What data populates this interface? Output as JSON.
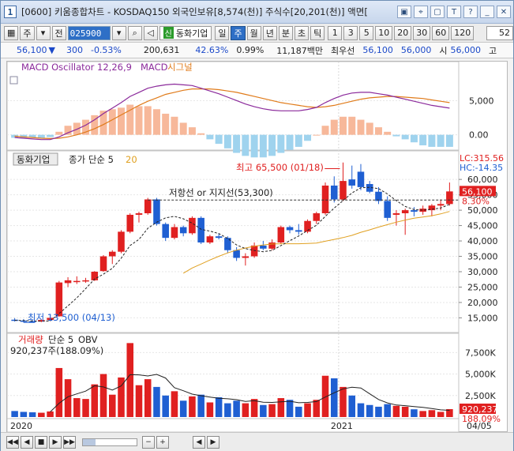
{
  "window": {
    "screen_no": "1",
    "title": "[0600] 키움종합차트 - KOSDAQ150 외국인보유[8,574(천)] 주식수[20,201(천)] 액면[",
    "icons": [
      "window-icon",
      "pin-icon",
      "restore-icon",
      "format-icon",
      "help-icon",
      "minimize-icon",
      "close-icon"
    ],
    "icon_glyphs": [
      "▣",
      "⌖",
      "▢",
      "T",
      "?",
      "_",
      "✕"
    ]
  },
  "toolbar": {
    "period_unit": "주",
    "all_label": "전",
    "stock_code": "025900",
    "stock_name": "동화기업",
    "sin_tag": "신",
    "period_buttons": [
      "일",
      "주",
      "월",
      "년",
      "분",
      "초",
      "틱"
    ],
    "active_period": "주",
    "minute_buttons": [
      "1",
      "3",
      "5",
      "10",
      "20",
      "30",
      "60",
      "120"
    ],
    "display_count": "52"
  },
  "price_bar": {
    "price": "56,100",
    "change_arrow": "▼",
    "change": "300",
    "change_rate": "-0.53%",
    "volume": "200,631",
    "volume_rate": "42.63%",
    "turnover": "0.99%",
    "amount": "11,187백만",
    "best_ask_label": "최우선",
    "best_ask": "56,100",
    "best_bid": "56,000",
    "open_label": "시",
    "open": "56,000",
    "extra": "고"
  },
  "macd_panel": {
    "legend_name": "MACD Oscillator 12,26,9",
    "legend_macd": "MACD",
    "legend_signal": "시그널",
    "ticks": [
      "5,000",
      "0.00"
    ],
    "colors": {
      "macd": "#8b2a9b",
      "signal": "#e07b1a",
      "pos": "#f7b89a",
      "neg": "#9fd3ee"
    }
  },
  "price_panel": {
    "legend_name": "동화기업",
    "legend_ma": "종가 단순 5",
    "legend_ma2": "20",
    "high_label": "최고 65,500 (01/18)",
    "low_label": "최저 13,500 (04/13)",
    "resistance_label": "저항선 or 지지선(53,300)",
    "lc_label": "LC:315.56",
    "hc_label": "HC:-14.35",
    "current_price_tag": "56,100",
    "current_rate_tag": "8.30%",
    "ticks": [
      "60,000",
      "55,000",
      "50,000",
      "45,000",
      "40,000",
      "35,000",
      "30,000",
      "25,000",
      "20,000",
      "15,000"
    ],
    "colors": {
      "up": "#e02020",
      "down": "#1f5fd2",
      "ma5": "#222222",
      "ma20": "#e0a020"
    }
  },
  "volume_panel": {
    "legend_name": "거래량",
    "legend_ma": "단순 5",
    "legend_obv": "OBV",
    "volume_info": "920,237주(188.09%)",
    "current_volume_tag": "920,237",
    "current_rate_tag": "188.09%",
    "ticks": [
      "7,500K",
      "5,000K",
      "2,500K"
    ]
  },
  "x_axis": {
    "labels": [
      "2020",
      "2021",
      "04/05"
    ]
  },
  "chart_data": {
    "type": "candlestick",
    "interval": "weekly",
    "ylim_price": [
      11000,
      68000
    ],
    "ylim_volume": [
      0,
      9000000
    ],
    "ylim_macd": [
      -2000,
      10000
    ],
    "candles": [
      {
        "o": 14400,
        "h": 14900,
        "l": 13800,
        "c": 14100
      },
      {
        "o": 14100,
        "h": 14600,
        "l": 13500,
        "c": 13900
      },
      {
        "o": 13900,
        "h": 14300,
        "l": 13500,
        "c": 13800
      },
      {
        "o": 13800,
        "h": 14500,
        "l": 13600,
        "c": 14300
      },
      {
        "o": 14300,
        "h": 15200,
        "l": 14000,
        "c": 15000
      },
      {
        "o": 15500,
        "h": 27000,
        "l": 15400,
        "c": 26500
      },
      {
        "o": 26300,
        "h": 28200,
        "l": 25000,
        "c": 27200
      },
      {
        "o": 26800,
        "h": 28500,
        "l": 26000,
        "c": 27000
      },
      {
        "o": 27000,
        "h": 28000,
        "l": 26400,
        "c": 27200
      },
      {
        "o": 27200,
        "h": 30200,
        "l": 27000,
        "c": 30000
      },
      {
        "o": 30200,
        "h": 35400,
        "l": 30000,
        "c": 35000
      },
      {
        "o": 35000,
        "h": 37000,
        "l": 32500,
        "c": 36500
      },
      {
        "o": 36500,
        "h": 43500,
        "l": 36000,
        "c": 43000
      },
      {
        "o": 43000,
        "h": 49000,
        "l": 42500,
        "c": 48500
      },
      {
        "o": 48500,
        "h": 49500,
        "l": 46000,
        "c": 49000
      },
      {
        "o": 49000,
        "h": 54000,
        "l": 48500,
        "c": 53500
      },
      {
        "o": 53500,
        "h": 54000,
        "l": 45000,
        "c": 45500
      },
      {
        "o": 45500,
        "h": 46000,
        "l": 40000,
        "c": 41000
      },
      {
        "o": 41000,
        "h": 45500,
        "l": 40500,
        "c": 44500
      },
      {
        "o": 44500,
        "h": 45000,
        "l": 41500,
        "c": 42500
      },
      {
        "o": 42500,
        "h": 48000,
        "l": 42000,
        "c": 47500
      },
      {
        "o": 47500,
        "h": 48000,
        "l": 39000,
        "c": 39500
      },
      {
        "o": 39500,
        "h": 42000,
        "l": 39000,
        "c": 41500
      },
      {
        "o": 41500,
        "h": 42500,
        "l": 40500,
        "c": 41000
      },
      {
        "o": 41000,
        "h": 41500,
        "l": 36000,
        "c": 37000
      },
      {
        "o": 37000,
        "h": 38000,
        "l": 33500,
        "c": 34500
      },
      {
        "o": 34500,
        "h": 36000,
        "l": 32000,
        "c": 35000
      },
      {
        "o": 35000,
        "h": 39500,
        "l": 34500,
        "c": 38500
      },
      {
        "o": 38500,
        "h": 40000,
        "l": 37000,
        "c": 37500
      },
      {
        "o": 37500,
        "h": 40500,
        "l": 37000,
        "c": 39500
      },
      {
        "o": 39500,
        "h": 45000,
        "l": 39000,
        "c": 44500
      },
      {
        "o": 44500,
        "h": 45000,
        "l": 42500,
        "c": 43500
      },
      {
        "o": 43500,
        "h": 45500,
        "l": 42000,
        "c": 43000
      },
      {
        "o": 43000,
        "h": 47000,
        "l": 42500,
        "c": 46500
      },
      {
        "o": 46500,
        "h": 49500,
        "l": 45500,
        "c": 49000
      },
      {
        "o": 49000,
        "h": 59000,
        "l": 48500,
        "c": 58000
      },
      {
        "o": 58000,
        "h": 61000,
        "l": 52500,
        "c": 53500
      },
      {
        "o": 53500,
        "h": 65500,
        "l": 53000,
        "c": 59500
      },
      {
        "o": 60000,
        "h": 64500,
        "l": 57000,
        "c": 58000
      },
      {
        "o": 62500,
        "h": 65000,
        "l": 56500,
        "c": 57500
      },
      {
        "o": 58500,
        "h": 59500,
        "l": 55500,
        "c": 56000
      },
      {
        "o": 56000,
        "h": 57500,
        "l": 52000,
        "c": 53000
      },
      {
        "o": 53000,
        "h": 54500,
        "l": 46500,
        "c": 47500
      },
      {
        "o": 48500,
        "h": 50000,
        "l": 45000,
        "c": 49000
      },
      {
        "o": 49000,
        "h": 50500,
        "l": 42000,
        "c": 50000
      },
      {
        "o": 50000,
        "h": 51000,
        "l": 48000,
        "c": 49500
      },
      {
        "o": 49500,
        "h": 51500,
        "l": 48500,
        "c": 50500
      },
      {
        "o": 50000,
        "h": 52000,
        "l": 48000,
        "c": 51500
      },
      {
        "o": 51500,
        "h": 53500,
        "l": 50000,
        "c": 52000
      },
      {
        "o": 52000,
        "h": 59000,
        "l": 51500,
        "c": 56100
      }
    ],
    "ma5": [
      14200,
      14100,
      14000,
      13900,
      14000,
      16400,
      18900,
      21500,
      24500,
      27600,
      29200,
      31100,
      34400,
      38500,
      40500,
      44100,
      46100,
      47500,
      48000,
      47200,
      45800,
      43800,
      43200,
      42400,
      40800,
      38700,
      37500,
      36900,
      36500,
      36900,
      38500,
      40100,
      41600,
      43400,
      45100,
      48000,
      50700,
      53100,
      55600,
      57300,
      57400,
      57000,
      55300,
      53100,
      51200,
      50200,
      50000,
      50300,
      50700,
      51900
    ],
    "ma20": [
      null,
      null,
      null,
      null,
      null,
      null,
      null,
      null,
      null,
      null,
      null,
      null,
      null,
      null,
      null,
      null,
      null,
      null,
      null,
      29500,
      31200,
      32500,
      33800,
      35000,
      36100,
      37000,
      37700,
      38300,
      38700,
      39000,
      39100,
      39100,
      39100,
      39200,
      39300,
      39900,
      40500,
      41100,
      41800,
      42800,
      43600,
      44500,
      45300,
      46100,
      46800,
      47400,
      47800,
      48200,
      48800,
      49600
    ],
    "volume": [
      700000,
      600000,
      550000,
      500000,
      650000,
      5700000,
      4400000,
      2200000,
      2100000,
      3800000,
      5000000,
      2600000,
      4600000,
      8600000,
      3700000,
      4400000,
      3500000,
      2500000,
      3000000,
      1900000,
      2400000,
      2600000,
      1700000,
      2300000,
      1600000,
      1900000,
      1600000,
      2100000,
      1400000,
      1500000,
      2200000,
      2000000,
      1200000,
      1600000,
      2000000,
      4800000,
      4500000,
      3500000,
      2500000,
      1600000,
      1400000,
      1200000,
      1500000,
      1300000,
      1200000,
      900000,
      700000,
      800000,
      600000,
      920237
    ],
    "macd": [
      -400,
      -500,
      -600,
      -700,
      -700,
      -300,
      300,
      800,
      1400,
      2200,
      3100,
      3900,
      4700,
      5600,
      6200,
      6800,
      7100,
      7300,
      7400,
      7300,
      7200,
      6800,
      6400,
      6000,
      5500,
      5000,
      4500,
      4100,
      3800,
      3600,
      3500,
      3500,
      3500,
      3700,
      4000,
      4700,
      5300,
      5800,
      6100,
      6200,
      6200,
      6000,
      5800,
      5500,
      5200,
      4900,
      4600,
      4300,
      4100,
      3900
    ],
    "signal": [
      -200,
      -300,
      -400,
      -500,
      -550,
      -500,
      -300,
      0,
      400,
      900,
      1500,
      2200,
      2900,
      3600,
      4300,
      4900,
      5400,
      5900,
      6200,
      6500,
      6700,
      6700,
      6700,
      6600,
      6400,
      6200,
      5900,
      5600,
      5300,
      5000,
      4700,
      4500,
      4300,
      4100,
      4000,
      4100,
      4300,
      4600,
      4900,
      5200,
      5400,
      5500,
      5600,
      5600,
      5500,
      5400,
      5300,
      5100,
      4900,
      4700
    ],
    "osc_scale": 2.2
  }
}
